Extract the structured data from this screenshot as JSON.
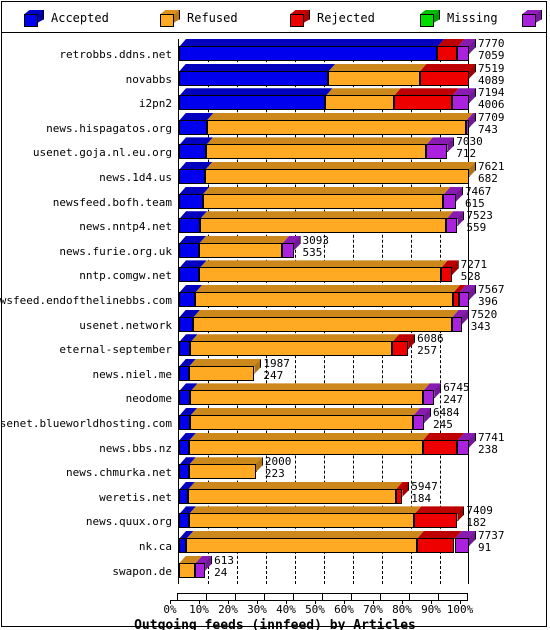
{
  "legend": {
    "items": [
      {
        "label": "Accepted",
        "color": "#0000ee",
        "icon": "cube-icon"
      },
      {
        "label": "Refused",
        "color": "#ffaa22",
        "icon": "cube-icon"
      },
      {
        "label": "Rejected",
        "color": "#ee0000",
        "icon": "cube-icon"
      },
      {
        "label": "Missing",
        "color": "#00dd00",
        "icon": "cube-icon"
      },
      {
        "label": "Spooled",
        "color": "#aa22dd",
        "icon": "cube-icon"
      }
    ]
  },
  "axis": {
    "x_title": "Outgoing feeds (innfeed) by Articles",
    "x_ticks": [
      "0%",
      "10%",
      "20%",
      "30%",
      "40%",
      "50%",
      "60%",
      "70%",
      "80%",
      "90%",
      "100%"
    ]
  },
  "chart_data": {
    "type": "bar",
    "orientation": "horizontal",
    "stacked": true,
    "normalized_percent": true,
    "title": "Outgoing feeds (innfeed) by Articles",
    "xlabel": "Outgoing feeds (innfeed) by Articles",
    "ylabel": "",
    "xlim": [
      0,
      100
    ],
    "xticks": [
      0,
      10,
      20,
      30,
      40,
      50,
      60,
      70,
      80,
      90,
      100
    ],
    "grid": true,
    "legend_position": "top",
    "series": [
      {
        "name": "Accepted",
        "color": "#0000ee"
      },
      {
        "name": "Refused",
        "color": "#ffaa22"
      },
      {
        "name": "Rejected",
        "color": "#ee0000"
      },
      {
        "name": "Missing",
        "color": "#00dd00"
      },
      {
        "name": "Spooled",
        "color": "#aa22dd"
      }
    ],
    "categories": [
      "retrobbs.ddns.net",
      "novabbs",
      "i2pn2",
      "news.hispagatos.org",
      "usenet.goja.nl.eu.org",
      "news.1d4.us",
      "newsfeed.bofh.team",
      "news.nntp4.net",
      "news.furie.org.uk",
      "nntp.comgw.net",
      "newsfeed.endofthelinebbs.com",
      "usenet.network",
      "eternal-september",
      "news.niel.me",
      "neodome",
      "usenet.blueworldhosting.com",
      "news.bbs.nz",
      "news.chmurka.net",
      "weretis.net",
      "news.quux.org",
      "nk.ca",
      "swapon.de"
    ],
    "rows": [
      {
        "label": "retrobbs.ddns.net",
        "value_top": "7770",
        "value_bottom": "7059",
        "bar_pct": 100,
        "segments": [
          {
            "s": "Accepted",
            "pct": 89.0
          },
          {
            "s": "Rejected",
            "pct": 7.0
          },
          {
            "s": "Spooled",
            "pct": 4.0
          }
        ]
      },
      {
        "label": "novabbs",
        "value_top": "7519",
        "value_bottom": "4089",
        "bar_pct": 100,
        "segments": [
          {
            "s": "Accepted",
            "pct": 51.5
          },
          {
            "s": "Refused",
            "pct": 31.5
          },
          {
            "s": "Rejected",
            "pct": 17.0
          }
        ]
      },
      {
        "label": "i2pn2",
        "value_top": "7194",
        "value_bottom": "4006",
        "bar_pct": 100,
        "segments": [
          {
            "s": "Accepted",
            "pct": 50.5
          },
          {
            "s": "Refused",
            "pct": 23.5
          },
          {
            "s": "Rejected",
            "pct": 20.0
          },
          {
            "s": "Spooled",
            "pct": 6.0
          }
        ]
      },
      {
        "label": "news.hispagatos.org",
        "value_top": "7709",
        "value_bottom": "743",
        "bar_pct": 100,
        "segments": [
          {
            "s": "Accepted",
            "pct": 9.5
          },
          {
            "s": "Refused",
            "pct": 89.5
          },
          {
            "s": "Spooled",
            "pct": 1.0
          }
        ]
      },
      {
        "label": "usenet.goja.nl.eu.org",
        "value_top": "7030",
        "value_bottom": "712",
        "bar_pct": 92.5,
        "segments": [
          {
            "s": "Accepted",
            "pct": 10.0
          },
          {
            "s": "Refused",
            "pct": 82.0
          },
          {
            "s": "Spooled",
            "pct": 8.0
          }
        ]
      },
      {
        "label": "news.1d4.us",
        "value_top": "7621",
        "value_bottom": "682",
        "bar_pct": 100,
        "segments": [
          {
            "s": "Accepted",
            "pct": 9.0
          },
          {
            "s": "Refused",
            "pct": 91.0
          }
        ]
      },
      {
        "label": "newsfeed.bofh.team",
        "value_top": "7467",
        "value_bottom": "615",
        "bar_pct": 95.5,
        "segments": [
          {
            "s": "Accepted",
            "pct": 8.5
          },
          {
            "s": "Refused",
            "pct": 87.0
          },
          {
            "s": "Spooled",
            "pct": 4.5
          }
        ]
      },
      {
        "label": "news.nntp4.net",
        "value_top": "7523",
        "value_bottom": "559",
        "bar_pct": 96.0,
        "segments": [
          {
            "s": "Accepted",
            "pct": 7.5
          },
          {
            "s": "Refused",
            "pct": 88.5
          },
          {
            "s": "Spooled",
            "pct": 4.0
          }
        ]
      },
      {
        "label": "news.furie.org.uk",
        "value_top": "3093",
        "value_bottom": "535",
        "bar_pct": 39.5,
        "segments": [
          {
            "s": "Accepted",
            "pct": 17.5
          },
          {
            "s": "Refused",
            "pct": 72.5
          },
          {
            "s": "Spooled",
            "pct": 10.0
          }
        ]
      },
      {
        "label": "nntp.comgw.net",
        "value_top": "7271",
        "value_bottom": "528",
        "bar_pct": 94.0,
        "segments": [
          {
            "s": "Accepted",
            "pct": 7.5
          },
          {
            "s": "Refused",
            "pct": 88.5
          },
          {
            "s": "Rejected",
            "pct": 4.0
          }
        ]
      },
      {
        "label": "newsfeed.endofthelinebbs.com",
        "value_top": "7567",
        "value_bottom": "396",
        "bar_pct": 100,
        "segments": [
          {
            "s": "Accepted",
            "pct": 5.5
          },
          {
            "s": "Refused",
            "pct": 89.0
          },
          {
            "s": "Rejected",
            "pct": 2.0
          },
          {
            "s": "Spooled",
            "pct": 3.5
          }
        ]
      },
      {
        "label": "usenet.network",
        "value_top": "7520",
        "value_bottom": "343",
        "bar_pct": 97.5,
        "segments": [
          {
            "s": "Accepted",
            "pct": 5.0
          },
          {
            "s": "Refused",
            "pct": 91.5
          },
          {
            "s": "Spooled",
            "pct": 3.5
          }
        ]
      },
      {
        "label": "eternal-september",
        "value_top": "6086",
        "value_bottom": "257",
        "bar_pct": 79.0,
        "segments": [
          {
            "s": "Accepted",
            "pct": 5.0
          },
          {
            "s": "Refused",
            "pct": 88.0
          },
          {
            "s": "Rejected",
            "pct": 7.0
          }
        ]
      },
      {
        "label": "news.niel.me",
        "value_top": "1987",
        "value_bottom": "247",
        "bar_pct": 26.0,
        "segments": [
          {
            "s": "Accepted",
            "pct": 13.0
          },
          {
            "s": "Refused",
            "pct": 87.0
          }
        ]
      },
      {
        "label": "neodome",
        "value_top": "6745",
        "value_bottom": "247",
        "bar_pct": 88.0,
        "segments": [
          {
            "s": "Accepted",
            "pct": 4.5
          },
          {
            "s": "Refused",
            "pct": 91.0
          },
          {
            "s": "Spooled",
            "pct": 4.5
          }
        ]
      },
      {
        "label": "usenet.blueworldhosting.com",
        "value_top": "6484",
        "value_bottom": "245",
        "bar_pct": 84.5,
        "segments": [
          {
            "s": "Accepted",
            "pct": 4.5
          },
          {
            "s": "Refused",
            "pct": 91.0
          },
          {
            "s": "Spooled",
            "pct": 4.5
          }
        ]
      },
      {
        "label": "news.bbs.nz",
        "value_top": "7741",
        "value_bottom": "238",
        "bar_pct": 100,
        "segments": [
          {
            "s": "Accepted",
            "pct": 3.5
          },
          {
            "s": "Refused",
            "pct": 80.5
          },
          {
            "s": "Rejected",
            "pct": 12.0
          },
          {
            "s": "Spooled",
            "pct": 4.0
          }
        ]
      },
      {
        "label": "news.chmurka.net",
        "value_top": "2000",
        "value_bottom": "223",
        "bar_pct": 26.5,
        "segments": [
          {
            "s": "Accepted",
            "pct": 12.5
          },
          {
            "s": "Refused",
            "pct": 87.5
          }
        ]
      },
      {
        "label": "weretis.net",
        "value_top": "5947",
        "value_bottom": "184",
        "bar_pct": 77.0,
        "segments": [
          {
            "s": "Accepted",
            "pct": 4.0
          },
          {
            "s": "Refused",
            "pct": 93.0
          },
          {
            "s": "Rejected",
            "pct": 3.0
          }
        ]
      },
      {
        "label": "news.quux.org",
        "value_top": "7409",
        "value_bottom": "182",
        "bar_pct": 96.0,
        "segments": [
          {
            "s": "Accepted",
            "pct": 3.5
          },
          {
            "s": "Refused",
            "pct": 81.0
          },
          {
            "s": "Rejected",
            "pct": 15.5
          }
        ]
      },
      {
        "label": "nk.ca",
        "value_top": "7737",
        "value_bottom": "91",
        "bar_pct": 100,
        "segments": [
          {
            "s": "Accepted",
            "pct": 2.5
          },
          {
            "s": "Refused",
            "pct": 79.5
          },
          {
            "s": "Rejected",
            "pct": 13.0
          },
          {
            "s": "Spooled",
            "pct": 5.0
          }
        ]
      },
      {
        "label": "swapon.de",
        "value_top": "613",
        "value_bottom": "24",
        "bar_pct": 9.0,
        "segments": [
          {
            "s": "Refused",
            "pct": 62.0
          },
          {
            "s": "Spooled",
            "pct": 38.0
          }
        ]
      }
    ]
  }
}
